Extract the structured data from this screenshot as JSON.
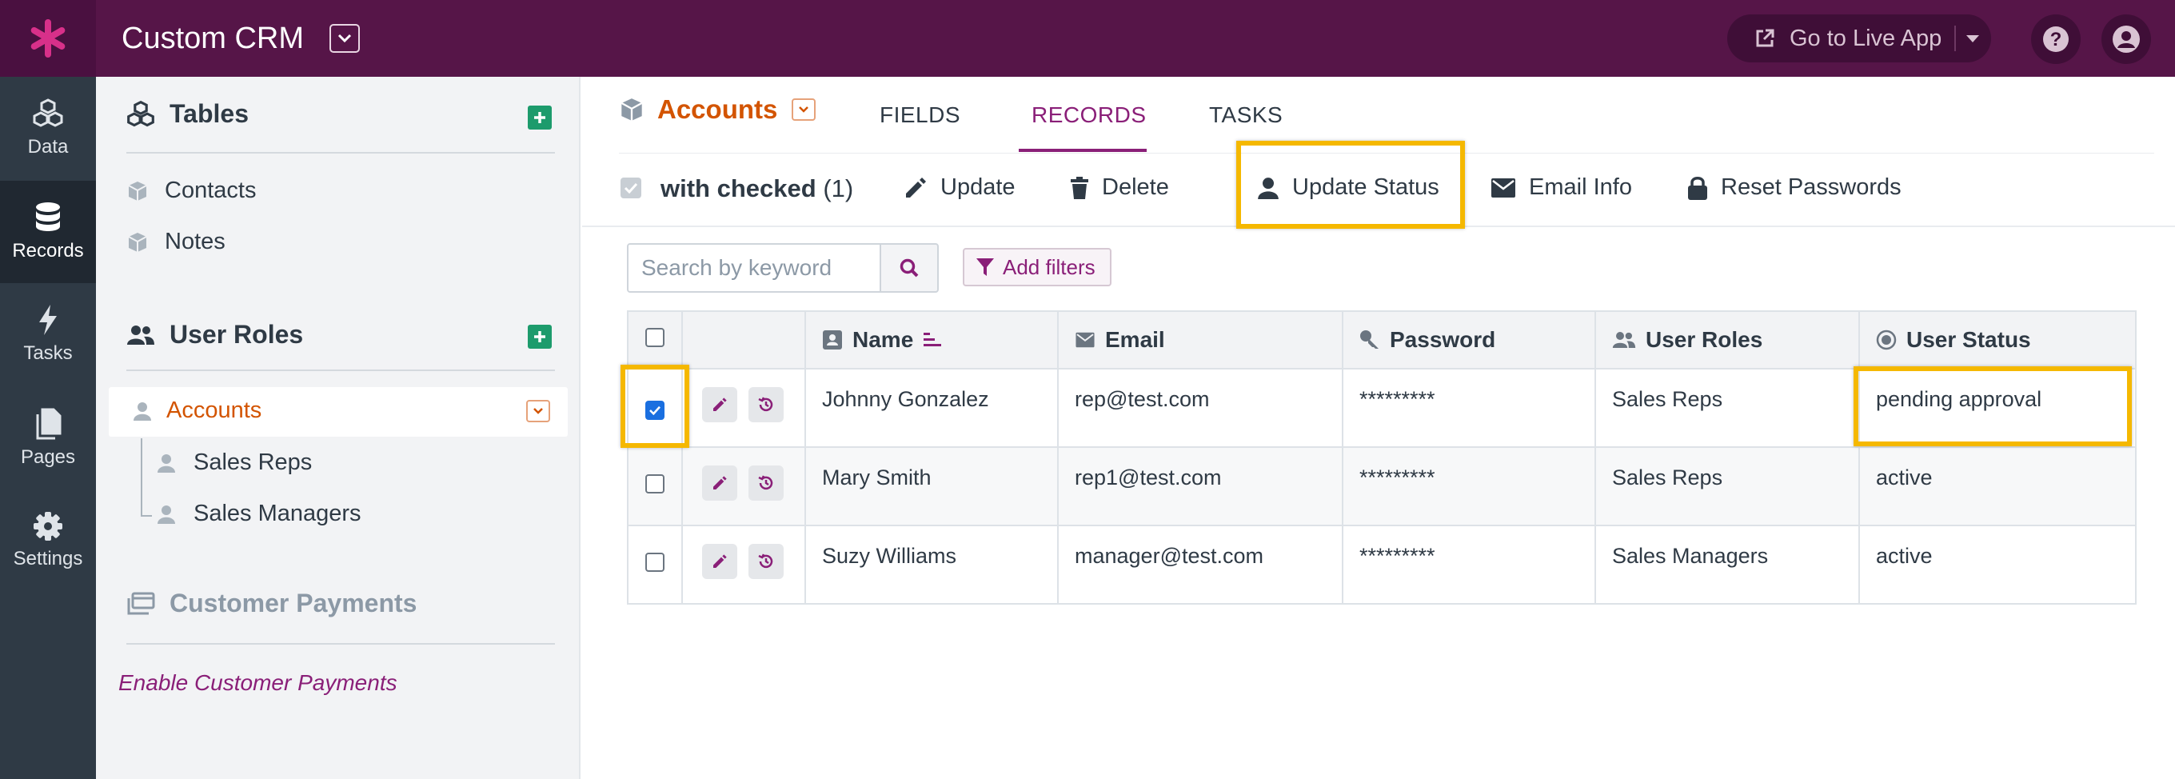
{
  "app": {
    "title": "Custom CRM",
    "live_app_label": "Go to Live App"
  },
  "rail": [
    {
      "label": "Data",
      "icon": "cubes-icon"
    },
    {
      "label": "Records",
      "icon": "database-icon"
    },
    {
      "label": "Tasks",
      "icon": "bolt-icon"
    },
    {
      "label": "Pages",
      "icon": "pages-icon"
    },
    {
      "label": "Settings",
      "icon": "gear-icon"
    }
  ],
  "sidebar": {
    "tables_heading": "Tables",
    "tables": [
      "Contacts",
      "Notes"
    ],
    "user_roles_heading": "User Roles",
    "accounts_label": "Accounts",
    "sub_roles": [
      "Sales Reps",
      "Sales Managers"
    ],
    "payments_heading": "Customer Payments",
    "enable_payments": "Enable Customer Payments"
  },
  "main": {
    "object_label": "Accounts",
    "tabs": [
      "FIELDS",
      "RECORDS",
      "TASKS"
    ],
    "active_tab": "RECORDS",
    "with_checked": "with checked",
    "checked_count": "(1)",
    "actions": [
      "Update",
      "Delete",
      "Update Status",
      "Email Info",
      "Reset Passwords"
    ],
    "search_placeholder": "Search by keyword",
    "filters_label": "Add filters",
    "columns": [
      "Name",
      "Email",
      "Password",
      "User Roles",
      "User Status"
    ],
    "rows": [
      {
        "name": "Johnny Gonzalez",
        "email": "rep@test.com",
        "password": "*********",
        "role": "Sales Reps",
        "status": "pending approval",
        "checked": true
      },
      {
        "name": "Mary Smith",
        "email": "rep1@test.com",
        "password": "*********",
        "role": "Sales Reps",
        "status": "active",
        "checked": false
      },
      {
        "name": "Suzy Williams",
        "email": "manager@test.com",
        "password": "*********",
        "role": "Sales Managers",
        "status": "active",
        "checked": false
      }
    ]
  },
  "colors": {
    "topbar": "#561548",
    "accent": "#8a1f78",
    "object_orange": "#d35400",
    "highlight": "#f5b800",
    "add_green": "#1d9b6c"
  }
}
